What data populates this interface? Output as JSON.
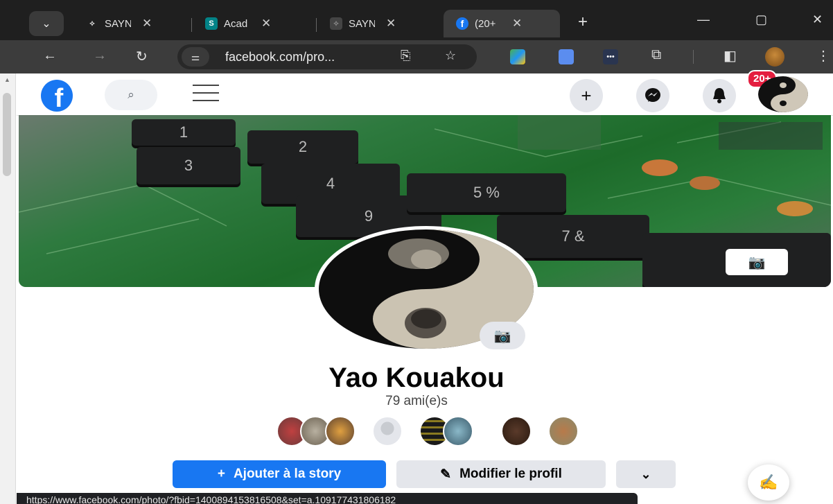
{
  "browser": {
    "tabs": [
      {
        "title": "SAYN",
        "favicon": "link-icon",
        "active": false
      },
      {
        "title": "Acad",
        "favicon": "sharepoint-icon",
        "active": false
      },
      {
        "title": "SAYN",
        "favicon": "link-icon",
        "active": false
      },
      {
        "title": "(20+",
        "favicon": "facebook-icon",
        "active": true
      }
    ],
    "close_glyph": "✕",
    "new_tab_glyph": "+",
    "url": "facebook.com/pro...",
    "status_url": "https://www.facebook.com/photo/?fbid=1400894153816508&set=a.109177431806182"
  },
  "facebook_nav": {
    "logo_letter": "f",
    "notifications_badge": "20+"
  },
  "profile": {
    "name": "Yao Kouakou",
    "friends_count": "79 ami(e)s",
    "friend_avatar_count": 8
  },
  "actions": {
    "add_story": "Ajouter à la story",
    "edit_profile": "Modifier le profil",
    "add_icon_glyph": "+"
  },
  "colors": {
    "facebook_blue": "#1877f2",
    "badge_red": "#e41e3f",
    "button_gray": "#e4e6eb",
    "chrome_dark": "#202124"
  }
}
